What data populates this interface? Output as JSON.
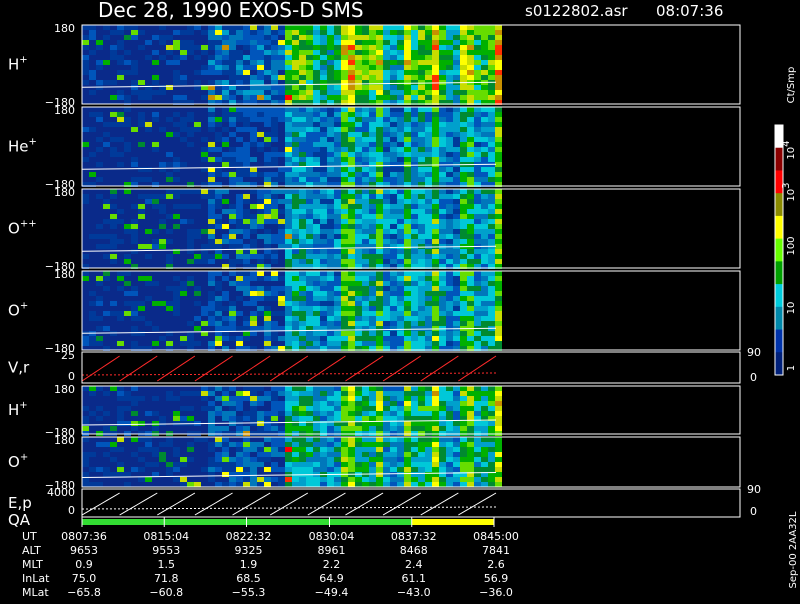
{
  "header": {
    "title": "Dec 28, 1990    EXOS-D SMS",
    "file": "s0122802.asr",
    "time": "08:07:36"
  },
  "chart_data": [
    {
      "type": "heatmap",
      "name": "H+",
      "label": "H",
      "sup": "+",
      "y_top": "180",
      "y_bot": "−180",
      "ylim": [
        -180,
        180
      ],
      "intensity": 1.0,
      "active_end": "0845:00"
    },
    {
      "type": "heatmap",
      "name": "He+",
      "label": "He",
      "sup": "+",
      "y_top": "180",
      "y_bot": "−180",
      "ylim": [
        -180,
        180
      ],
      "intensity": 0.55,
      "active_end": "0845:00"
    },
    {
      "type": "heatmap",
      "name": "O++",
      "label": "O",
      "sup": "++",
      "y_top": "180",
      "y_bot": "−180",
      "ylim": [
        -180,
        180
      ],
      "intensity": 0.6,
      "active_end": "0845:00"
    },
    {
      "type": "heatmap",
      "name": "O+",
      "label": "O",
      "sup": "+",
      "y_top": "180",
      "y_bot": "−180",
      "ylim": [
        -180,
        180
      ],
      "intensity": 0.65,
      "active_end": "0845:00"
    },
    {
      "type": "line",
      "name": "V,r",
      "label": "V,r",
      "y_top": "25",
      "y_mid": "0",
      "right_top": "90",
      "right_bot": "0",
      "color": "#ff2a2a"
    },
    {
      "type": "heatmap",
      "name": "H+ (2)",
      "label": "H",
      "sup": "+",
      "y_top": "180",
      "y_bot": "−180",
      "ylim": [
        -180,
        180
      ],
      "intensity": 0.8,
      "active_end": "0845:00"
    },
    {
      "type": "heatmap",
      "name": "O+ (2)",
      "label": "O",
      "sup": "+",
      "y_top": "180",
      "y_bot": "−180",
      "ylim": [
        -180,
        180
      ],
      "intensity": 0.75,
      "active_end": "0845:00"
    },
    {
      "type": "line",
      "name": "E,p",
      "label": "E,p",
      "label2": "QA",
      "y_top": "4000",
      "y_mid": "0",
      "right_top": "90",
      "right_bot": "0",
      "color": "#ffffff",
      "qa": [
        {
          "color": "#33dd33",
          "from": "0807:36",
          "to": "0837:32"
        },
        {
          "color": "#ffff00",
          "from": "0837:32",
          "to": "0845:00"
        }
      ]
    }
  ],
  "time_axis": {
    "ticks": [
      "0807:36",
      "0815:04",
      "0822:32",
      "0830:04",
      "0837:32",
      "0845:00"
    ]
  },
  "table": {
    "rows": [
      {
        "label": "UT",
        "values": [
          "0807:36",
          "0815:04",
          "0822:32",
          "0830:04",
          "0837:32",
          "0845:00"
        ]
      },
      {
        "label": "ALT",
        "values": [
          "9653",
          "9553",
          "9325",
          "8961",
          "8468",
          "7841"
        ]
      },
      {
        "label": "MLT",
        "values": [
          "0.9",
          "1.5",
          "1.9",
          "2.2",
          "2.4",
          "2.6"
        ]
      },
      {
        "label": "InLat",
        "values": [
          "75.0",
          "71.8",
          "68.5",
          "64.9",
          "61.1",
          "56.9"
        ]
      },
      {
        "label": "MLat",
        "values": [
          "−65.8",
          "−60.8",
          "−55.3",
          "−49.4",
          "−43.0",
          "−36.0"
        ]
      }
    ]
  },
  "colorbar": {
    "unit": "Ct/Smp",
    "labels": [
      "10",
      "10",
      "100",
      "10",
      "1"
    ],
    "exponents": [
      "4",
      "3",
      "",
      "",
      ""
    ],
    "colors": [
      "#ffffff",
      "#8b0000",
      "#ff0000",
      "#8b8b00",
      "#ffff00",
      "#66ff00",
      "#00a000",
      "#00ccdd",
      "#0088aa",
      "#0033aa",
      "#00207a"
    ]
  },
  "footer": {
    "stamp": "Sep-00 2AA32L"
  }
}
